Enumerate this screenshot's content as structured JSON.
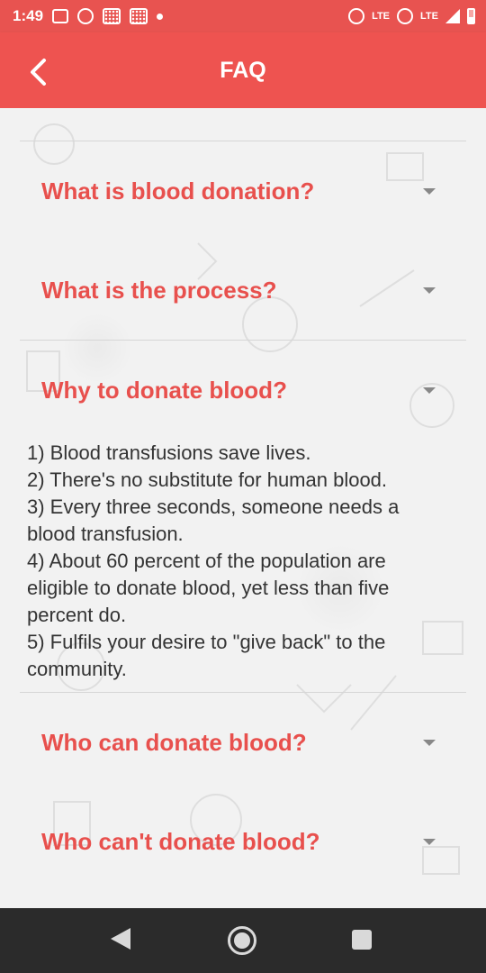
{
  "status_bar": {
    "time": "1:49",
    "network_labels": [
      "LTE",
      "LTE"
    ]
  },
  "app_bar": {
    "title": "FAQ"
  },
  "faq": [
    {
      "question": "What is blood donation?",
      "expanded": false
    },
    {
      "question": "What is the process?",
      "expanded": false
    },
    {
      "question": "Why to donate blood?",
      "expanded": true,
      "answer_lines": [
        "1) Blood transfusions save lives.",
        "2) There's no substitute for human blood.",
        "3) Every three seconds, someone needs a blood transfusion.",
        "4) About 60 percent of the population are eligible to donate blood, yet less than five percent do.",
        "5) Fulfils your desire to \"give back\" to the community."
      ]
    },
    {
      "question": "Who can donate blood?",
      "expanded": false
    },
    {
      "question": "Who can't donate blood?",
      "expanded": false
    }
  ],
  "colors": {
    "accent": "#ee5350",
    "question_text": "#e8504d",
    "nav_bar": "#2b2b2b"
  }
}
